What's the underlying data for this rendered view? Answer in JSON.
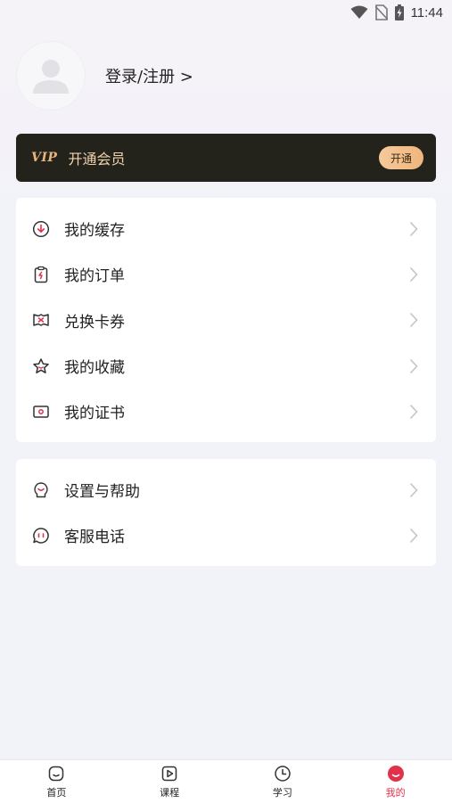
{
  "status_bar": {
    "time": "11:44"
  },
  "profile": {
    "login_label": "登录/注册 >"
  },
  "vip": {
    "badge": "VIP",
    "label": "开通会员",
    "button": "开通"
  },
  "menu_main": [
    {
      "icon": "download-icon",
      "label": "我的缓存"
    },
    {
      "icon": "clipboard-icon",
      "label": "我的订单"
    },
    {
      "icon": "ticket-icon",
      "label": "兑换卡券"
    },
    {
      "icon": "star-icon",
      "label": "我的收藏"
    },
    {
      "icon": "certificate-icon",
      "label": "我的证书"
    }
  ],
  "menu_secondary": [
    {
      "icon": "settings-help-icon",
      "label": "设置与帮助"
    },
    {
      "icon": "chat-icon",
      "label": "客服电话"
    }
  ],
  "tabbar": {
    "items": [
      {
        "icon": "home-icon",
        "label": "首页",
        "active": false
      },
      {
        "icon": "play-icon",
        "label": "课程",
        "active": false
      },
      {
        "icon": "clock-icon",
        "label": "学习",
        "active": false
      },
      {
        "icon": "smile-icon",
        "label": "我的",
        "active": true
      }
    ]
  },
  "colors": {
    "accent": "#e0324b",
    "vip_bg": "#23231c",
    "vip_gold": "#f0b67c"
  }
}
